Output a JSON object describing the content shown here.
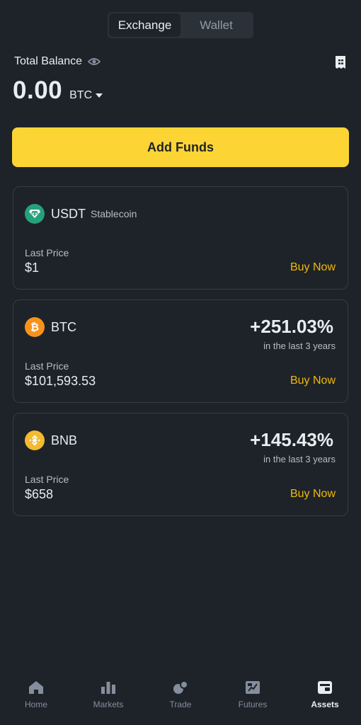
{
  "tabs": [
    {
      "label": "Exchange",
      "active": true
    },
    {
      "label": "Wallet",
      "active": false
    }
  ],
  "balance": {
    "label": "Total Balance",
    "value": "0.00",
    "unit": "BTC"
  },
  "add_funds_label": "Add Funds",
  "cards": [
    {
      "symbol": "USDT",
      "subtitle": "Stablecoin",
      "change": "",
      "period": "",
      "price_label": "Last Price",
      "price": "$1",
      "action": "Buy Now",
      "icon": "tether-icon",
      "icon_color": "#26a17b"
    },
    {
      "symbol": "BTC",
      "subtitle": "",
      "change": "+251.03%",
      "period": "in the last 3 years",
      "price_label": "Last Price",
      "price": "$101,593.53",
      "action": "Buy Now",
      "icon": "bitcoin-icon",
      "icon_color": "#f7931a"
    },
    {
      "symbol": "BNB",
      "subtitle": "",
      "change": "+145.43%",
      "period": "in the last 3 years",
      "price_label": "Last Price",
      "price": "$658",
      "action": "Buy Now",
      "icon": "bnb-icon",
      "icon_color": "#f3ba2f"
    }
  ],
  "nav": [
    {
      "label": "Home",
      "icon": "home-icon",
      "active": false
    },
    {
      "label": "Markets",
      "icon": "markets-icon",
      "active": false
    },
    {
      "label": "Trade",
      "icon": "trade-icon",
      "active": false
    },
    {
      "label": "Futures",
      "icon": "futures-icon",
      "active": false
    },
    {
      "label": "Assets",
      "icon": "assets-icon",
      "active": true
    }
  ],
  "colors": {
    "background": "#1e2329",
    "accent": "#fcd535",
    "action_text": "#f0b90b"
  }
}
